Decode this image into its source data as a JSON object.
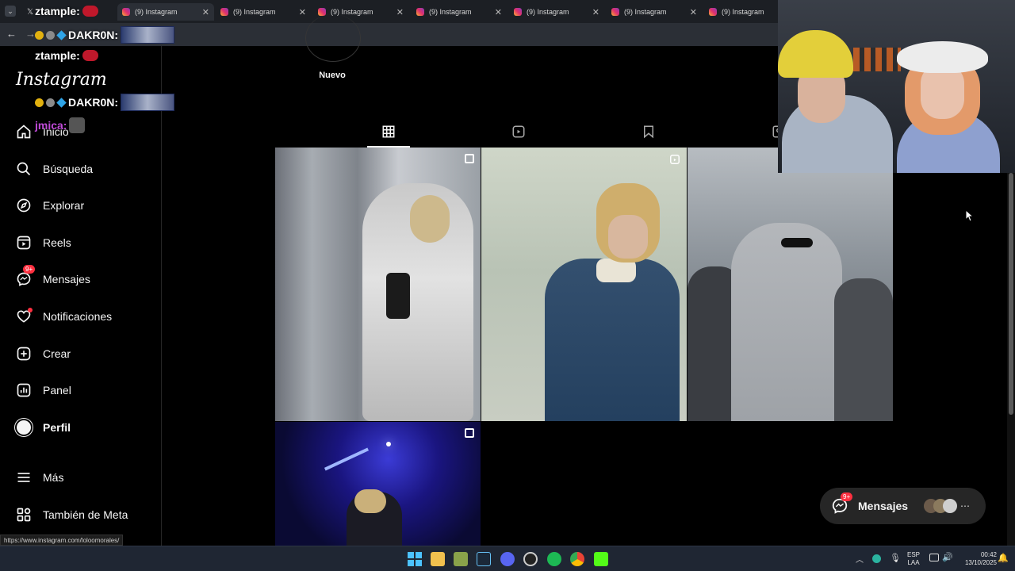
{
  "browser": {
    "tabs": [
      {
        "title": ""
      },
      {
        "title": "(9) Instagram"
      },
      {
        "title": "(9) Instagram"
      },
      {
        "title": "(9) Instagram"
      },
      {
        "title": "(9) Instagram"
      },
      {
        "title": "(9) Instagram"
      },
      {
        "title": "(9) Instagram"
      },
      {
        "title": "(9) Instagram"
      }
    ],
    "status_url": "https://www.instagram.com/loloomorales/"
  },
  "chat": [
    {
      "user": "ztample:"
    },
    {
      "user": "DAKR0N:"
    },
    {
      "user": "ztample:"
    },
    {
      "user": "DAKR0N:"
    },
    {
      "user": "jmica:"
    }
  ],
  "sidebar": {
    "logo": "Instagram",
    "items": [
      {
        "label": "Inicio",
        "icon": "home-icon"
      },
      {
        "label": "Búsqueda",
        "icon": "search-icon"
      },
      {
        "label": "Explorar",
        "icon": "compass-icon"
      },
      {
        "label": "Reels",
        "icon": "reels-icon"
      },
      {
        "label": "Mensajes",
        "icon": "messenger-icon",
        "badge": "9+"
      },
      {
        "label": "Notificaciones",
        "icon": "heart-icon"
      },
      {
        "label": "Crear",
        "icon": "plus-square-icon"
      },
      {
        "label": "Panel",
        "icon": "chart-icon"
      },
      {
        "label": "Perfil",
        "icon": "profile-avatar"
      }
    ],
    "more": {
      "label": "Más"
    },
    "meta": {
      "label": "También de Meta"
    }
  },
  "profile": {
    "highlight_new": "Nuevo"
  },
  "messages_pill": {
    "label": "Mensajes",
    "badge": "9+"
  },
  "taskbar": {
    "lang_top": "ESP",
    "lang_bottom": "LAA",
    "time": "00:42",
    "date": "13/10/2025"
  },
  "colors": {
    "accent_badge": "#ff3040",
    "tab_active_underline": "#f5f5f5",
    "background": "#000000"
  }
}
